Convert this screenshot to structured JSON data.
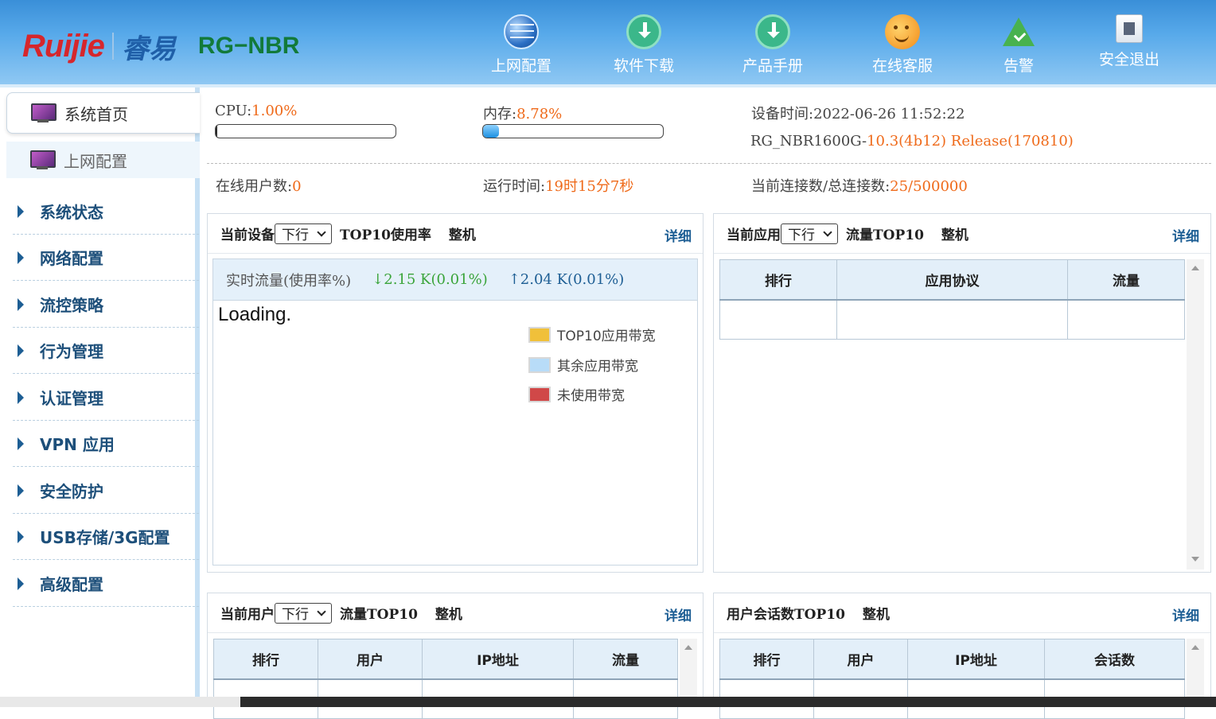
{
  "header": {
    "brand": "Ruijie",
    "brand_cn": "睿易",
    "model": "RG−NBR",
    "nav": [
      {
        "label": "上网配置",
        "icon": "globe-icon"
      },
      {
        "label": "软件下载",
        "icon": "download-icon"
      },
      {
        "label": "产品手册",
        "icon": "manual-download-icon"
      },
      {
        "label": "在线客服",
        "icon": "customer-service-icon"
      },
      {
        "label": "告警",
        "icon": "alarm-icon"
      },
      {
        "label": "安全退出",
        "icon": "exit-icon"
      }
    ]
  },
  "sidebar": {
    "home": "系统首页",
    "net_config": "上网配置",
    "menus": [
      "系统状态",
      "网络配置",
      "流控策略",
      "行为管理",
      "认证管理",
      "VPN 应用",
      "安全防护",
      "USB存储/3G配置",
      "高级配置"
    ]
  },
  "stats": {
    "cpu_label": "CPU:",
    "cpu_value": "1.00%",
    "cpu_fraction": 0.01,
    "mem_label": "内存:",
    "mem_value": "8.78%",
    "mem_fraction": 0.0878,
    "device_time": "设备时间:2022-06-26 11:52:22",
    "version_prefix": "RG_NBR1600G-",
    "version": "10.3(4b12) Release(170810)",
    "online_users_label": "在线用户数:",
    "online_users": "0",
    "uptime_label": "运行时间:",
    "uptime": "19时15分7秒",
    "conn_label": "当前连接数/总连接数:",
    "conn": "25/500000"
  },
  "panel_device": {
    "prefix": "当前设备",
    "select": "下行",
    "title": "TOP10使用率",
    "scope": "整机",
    "detail": "详细",
    "flow_label": "实时流量(使用率%)",
    "down": "↓2.15 K(0.01%)",
    "up": "↑2.04 K(0.01%)",
    "loading": "Loading.",
    "legend": [
      {
        "label": "TOP10应用带宽",
        "color": "#f0c03a"
      },
      {
        "label": "其余应用带宽",
        "color": "#b8dcf8"
      },
      {
        "label": "未使用带宽",
        "color": "#d04848"
      }
    ]
  },
  "panel_app": {
    "prefix": "当前应用",
    "select": "下行",
    "title": "流量TOP10",
    "scope": "整机",
    "detail": "详细",
    "columns": [
      "排行",
      "应用协议",
      "流量"
    ]
  },
  "panel_user": {
    "prefix": "当前用户",
    "select": "下行",
    "title": "流量TOP10",
    "scope": "整机",
    "detail": "详细",
    "columns": [
      "排行",
      "用户",
      "IP地址",
      "流量"
    ]
  },
  "panel_session": {
    "title": "用户会话数TOP10",
    "scope": "整机",
    "detail": "详细",
    "columns": [
      "排行",
      "用户",
      "IP地址",
      "会话数"
    ]
  }
}
